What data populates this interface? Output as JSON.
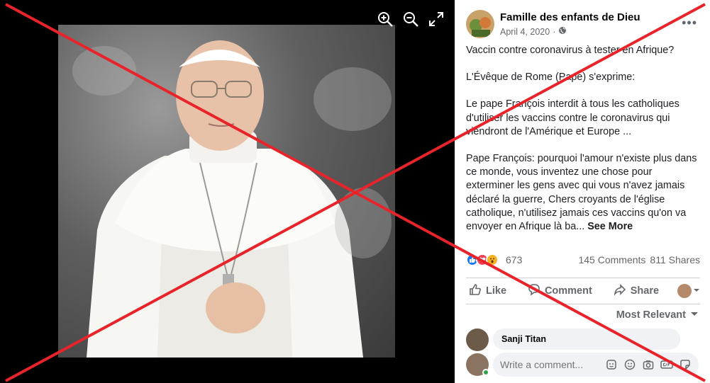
{
  "viewer": {
    "tools": [
      {
        "icon": "zoom-in-icon"
      },
      {
        "icon": "zoom-out-icon"
      },
      {
        "icon": "fullscreen-icon"
      }
    ]
  },
  "post": {
    "page_name": "Famille des enfants de Dieu",
    "date": "April 4, 2020",
    "audience_separator": "·",
    "audience_icon": "globe-icon",
    "more": "•••",
    "paragraphs": [
      "Vaccin contre coronavirus à tester en Afrique?",
      "L'Évêque de Rome (Pape) s'exprime:",
      "Le pape François interdit à tous les catholiques d'utiliser les vaccins contre le coronavirus qui viendront de l'Amérique et Europe ...",
      "Pape François: pourquoi l'amour n'existe plus dans ce monde, vous inventez une chose pour exterminer les gens avec qui vous n'avez jamais déclaré la guerre, Chers croyants de l'église catholique, n'utilisez jamais ces vaccins qu'on va envoyer en Afrique là ba..."
    ],
    "see_more": "See More"
  },
  "engagement": {
    "reaction_count": "673",
    "reaction_icons": [
      "like-reaction-icon",
      "love-reaction-icon",
      "wow-reaction-icon"
    ],
    "comments": "145 Comments",
    "shares": "811 Shares"
  },
  "actions": {
    "like": "Like",
    "comment": "Comment",
    "share": "Share"
  },
  "comments": {
    "sort_label": "Most Relevant",
    "first_commenter": "Sanji Titan",
    "write_placeholder": "Write a comment..."
  },
  "colors": {
    "overlay_red": "#e8242a",
    "like_blue": "#1877f2",
    "love_red": "#f33e58",
    "wow_yellow": "#f7b125"
  }
}
